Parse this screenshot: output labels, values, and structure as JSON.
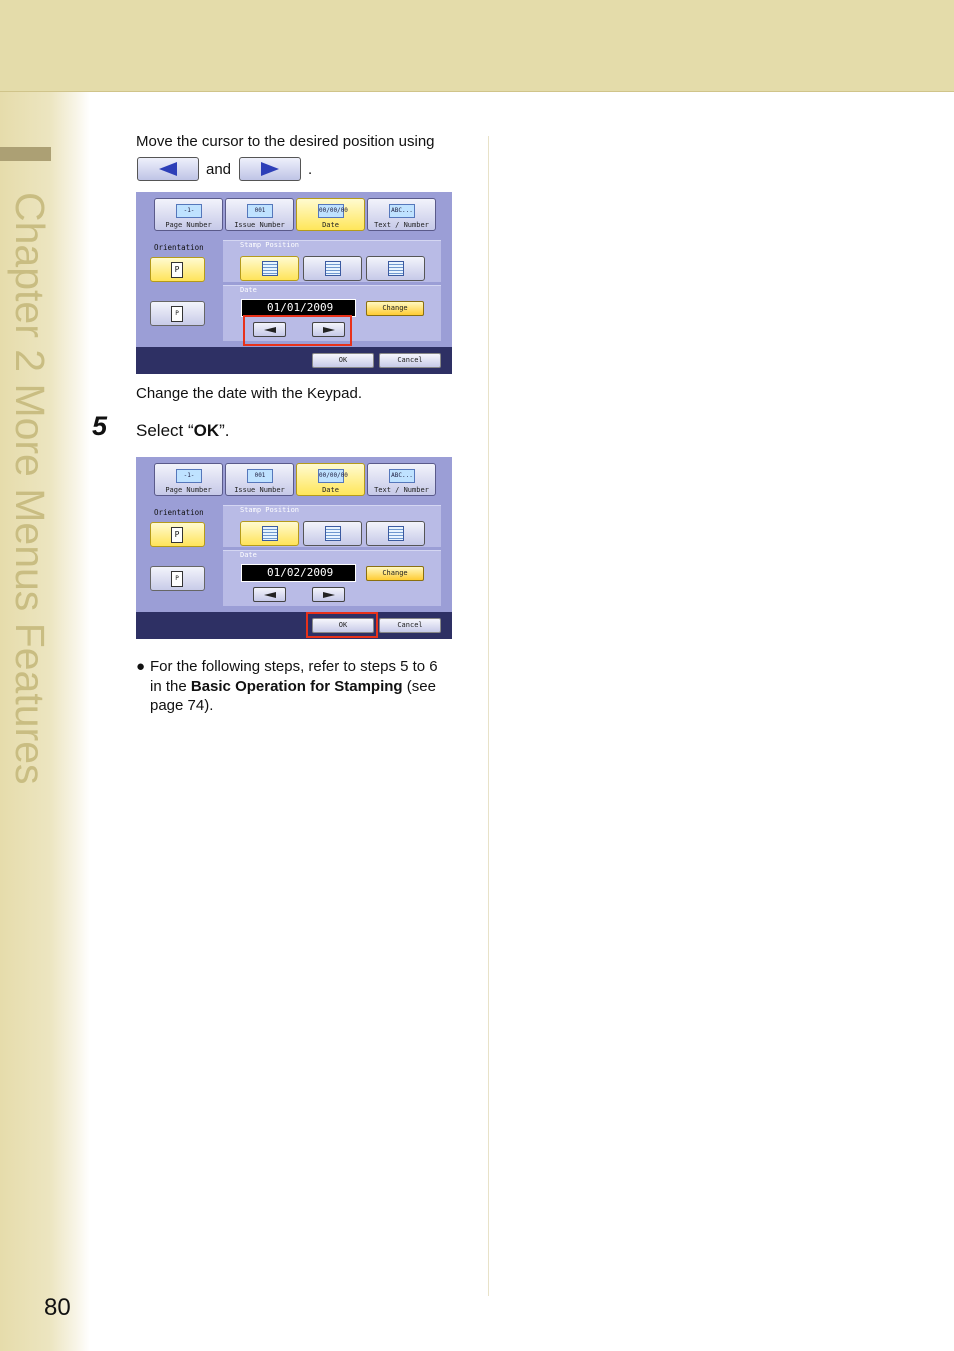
{
  "sidebar": {
    "chapter_title": "Chapter 2   More Menus Features",
    "page_number": "80"
  },
  "step4": {
    "text_before": "Move the cursor to the desired position using",
    "and": "and",
    "period": ".",
    "after_text": "Change the date with the Keypad."
  },
  "step5": {
    "number": "5",
    "pre": "Select “",
    "bold": "OK",
    "post": "”."
  },
  "note": {
    "line1": "For the following steps, refer to steps 5 to 6",
    "line2_pre": "in the ",
    "line2_bold": "Basic Operation for Stamping",
    "line2_post": " (see",
    "line3": "page 74)."
  },
  "panel": {
    "tabs": [
      {
        "label": "Page Number",
        "icon_text": "-1-"
      },
      {
        "label": "Issue Number",
        "icon_text": "001"
      },
      {
        "label": "Date",
        "icon_text": "00/00/00"
      },
      {
        "label": "Text / Number",
        "icon_text": "ABC..."
      }
    ],
    "orientation_label": "Orientation",
    "orientation_options": [
      "P",
      "P"
    ],
    "stamp_position_label": "Stamp Position",
    "date_label": "Date",
    "change_label": "Change",
    "ok_label": "OK",
    "cancel_label": "Cancel"
  },
  "panel1_date": "01/01/2009",
  "panel2_date": "01/02/2009",
  "colors": {
    "highlight": "#e8311a",
    "active_yellow": "#ffe65a",
    "panel_bg": "#9b9ed6",
    "bar": "#2e3064"
  }
}
